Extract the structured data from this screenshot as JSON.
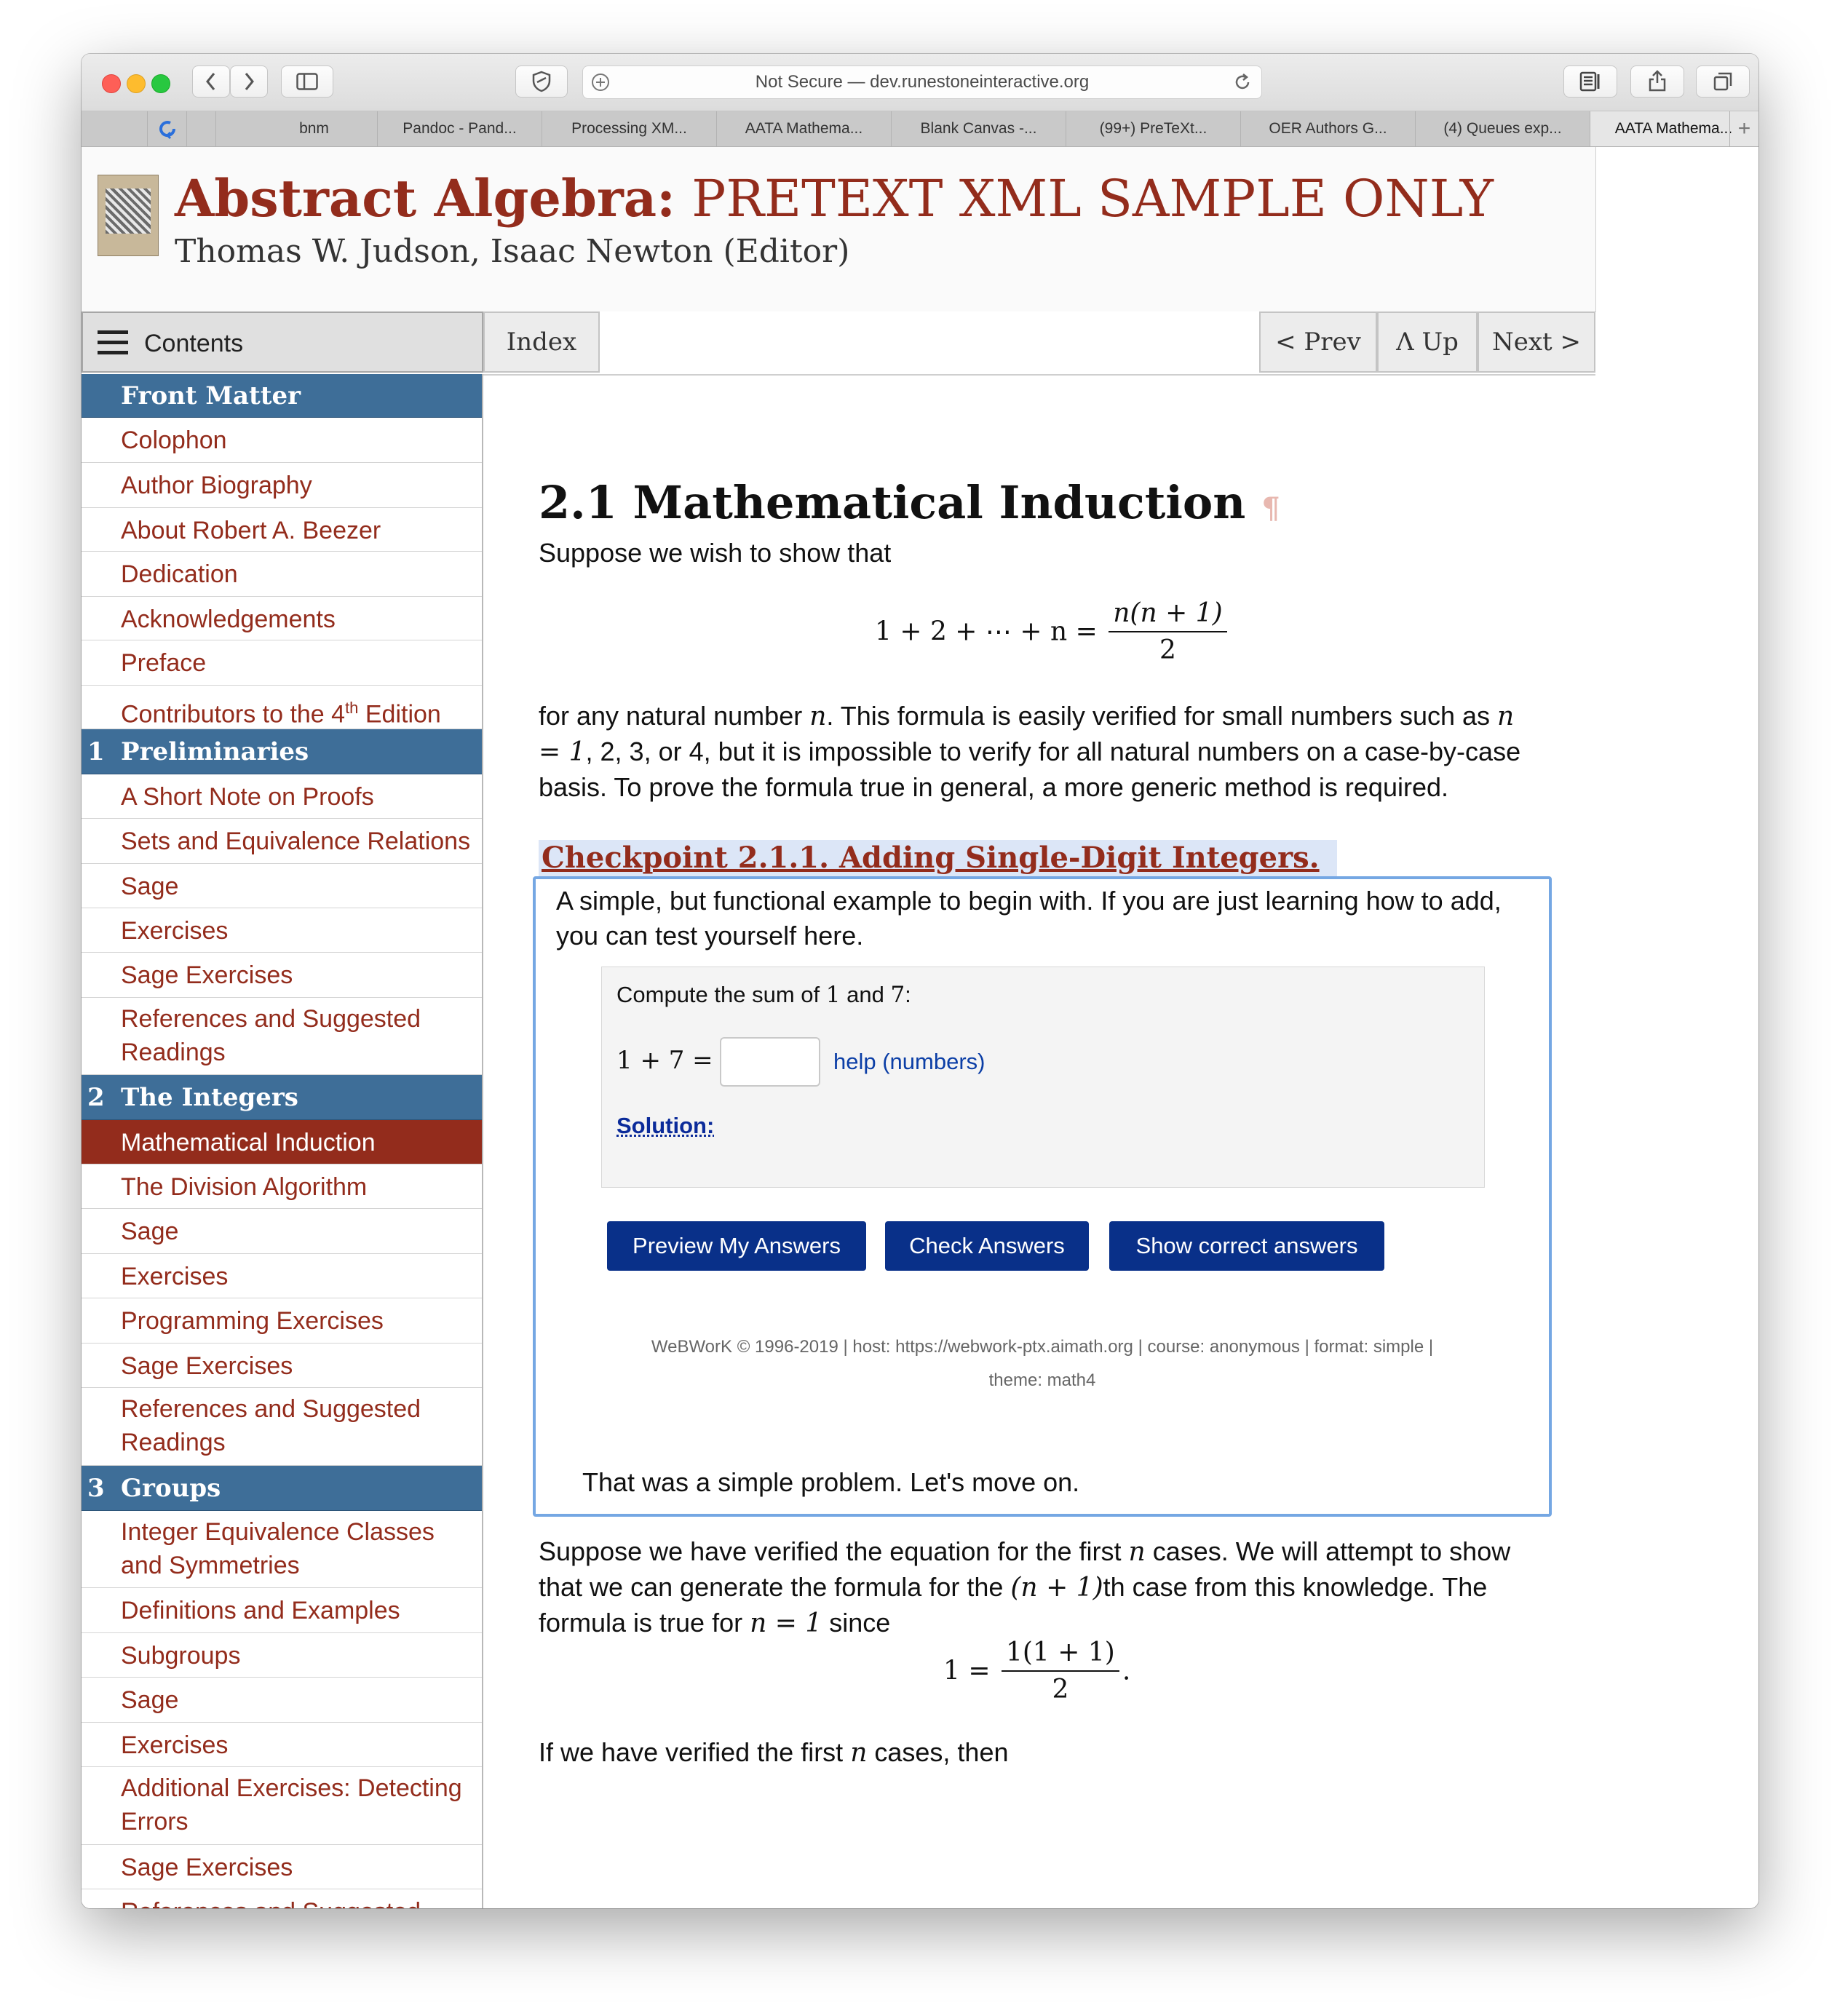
{
  "browser": {
    "url_text": "Not Secure — dev.runestoneinteractive.org",
    "tabs": [
      "bnm",
      "Pandoc - Pand...",
      "Processing XM...",
      "AATA Mathema...",
      "Blank Canvas -...",
      "(99+) PreTeXt...",
      "OER Authors G...",
      "(4) Queues exp...",
      "AATA Mathema..."
    ],
    "new_tab": "+"
  },
  "book": {
    "title_bold": "Abstract Algebra:",
    "title_rest": "PRETEXT XML SAMPLE ONLY",
    "authors": "Thomas W. Judson, Isaac Newton (Editor)"
  },
  "nav": {
    "contents": "Contents",
    "index": "Index",
    "prev": "< Prev",
    "up": "Λ Up",
    "next": "Next >"
  },
  "sidebar": {
    "front_matter": {
      "label": "Front Matter",
      "items": [
        "Colophon",
        "Author Biography",
        "About Robert A. Beezer",
        "Dedication",
        "Acknowledgements",
        "Preface"
      ],
      "contributors": {
        "pre": "Contributors to the 4",
        "sup": "th",
        "post": " Edition"
      }
    },
    "ch1": {
      "num": "1",
      "label": "Preliminaries",
      "items": [
        "A Short Note on Proofs",
        "Sets and Equivalence Relations",
        "Sage",
        "Exercises",
        "Sage Exercises"
      ],
      "refs_line1": "References and Suggested",
      "refs_line2": "Readings"
    },
    "ch2": {
      "num": "2",
      "label": "The Integers",
      "items": [
        "Mathematical Induction",
        "The Division Algorithm",
        "Sage",
        "Exercises",
        "Programming Exercises",
        "Sage Exercises"
      ],
      "refs_line1": "References and Suggested",
      "refs_line2": "Readings"
    },
    "ch3": {
      "num": "3",
      "label": "Groups",
      "item1_line1": "Integer Equivalence Classes",
      "item1_line2": "and Symmetries",
      "items": [
        "Definitions and Examples",
        "Subgroups",
        "Sage",
        "Exercises"
      ],
      "additional_line1": "Additional Exercises: Detecting",
      "additional_line2": "Errors",
      "sage_ex": "Sage Exercises",
      "partial": "References and Suggested"
    }
  },
  "content": {
    "section_title": "2.1 Mathematical Induction",
    "pilcrow": "¶",
    "intro": "Suppose we wish to show that",
    "eq1_lhs": "1 + 2 + ⋯ + n =",
    "eq1_num": "n(n + 1)",
    "eq1_den": "2",
    "p2_a": "for any natural number ",
    "p2_n": "n",
    "p2_b": ". This formula is easily verified for small numbers such as ",
    "p2_eq": "n = 1",
    "p2_c": ", 2, 3, or 4, but it is impossible to verify for all natural numbers on a case-by-case basis. To prove the formula true in general, a more generic method is required.",
    "checkpoint_title": "Checkpoint 2.1.1. Adding Single-Digit Integers.",
    "checkpoint_intro": "A simple, but functional example to begin with. If you are just learning how to add, you can test yourself here.",
    "ww_prompt_a": "Compute the sum of ",
    "ww_1": "1",
    "ww_and": " and ",
    "ww_7": "7",
    "ww_colon": ":",
    "ww_eq": "1 + 7 =",
    "ww_input_value": "",
    "help_link": "help (numbers)",
    "solution": "Solution:",
    "btn_preview": "Preview My Answers",
    "btn_check": "Check Answers",
    "btn_show": "Show correct answers",
    "ww_footer_1": "WeBWorK © 1996-2019 | host: https://webwork-ptx.aimath.org | course: anonymous | format: simple |",
    "ww_footer_2": "theme: math4",
    "after_ww": "That was a simple problem. Let's move on.",
    "p3_a": "Suppose we have verified the equation for the first ",
    "p3_n": "n",
    "p3_b": " cases. We will attempt to show that we can generate the formula for the ",
    "p3_np1": "(n + 1)",
    "p3_c": "th case from this knowledge. The formula is true for ",
    "p3_eq": "n = 1",
    "p3_d": " since",
    "eq2_lhs": "1 =",
    "eq2_num": "1(1 + 1)",
    "eq2_den": "2",
    "eq2_dot": ".",
    "p4_a": "If we have verified the first ",
    "p4_n": "n",
    "p4_b": " cases, then"
  }
}
